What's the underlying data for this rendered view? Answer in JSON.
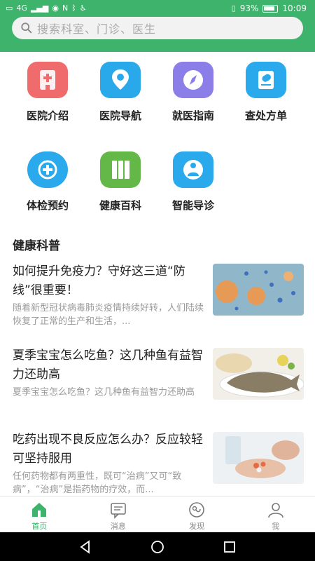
{
  "status_bar": {
    "network": "4G",
    "battery": "93%",
    "time": "10:09"
  },
  "search": {
    "placeholder": "搜索科室、门诊、医生"
  },
  "services": [
    {
      "label": "医院介绍",
      "icon": "hospital-icon",
      "color": "#f06b6b"
    },
    {
      "label": "医院导航",
      "icon": "location-pin-icon",
      "color": "#29a8ea"
    },
    {
      "label": "就医指南",
      "icon": "compass-icon",
      "color": "#8b7ee8"
    },
    {
      "label": "查处方单",
      "icon": "prescription-icon",
      "color": "#2aa9ec"
    },
    {
      "label": "体检预约",
      "icon": "checkup-icon",
      "color": "#2aa9ec"
    },
    {
      "label": "健康百科",
      "icon": "encyclopedia-icon",
      "color": "#64b847"
    },
    {
      "label": "智能导诊",
      "icon": "smart-guide-icon",
      "color": "#2aa9ec"
    }
  ],
  "section": {
    "title": "健康科普"
  },
  "articles": [
    {
      "title": "如何提升免疫力？守好这三道“防线”很重要！",
      "desc": "随着新型冠状病毒肺炎疫情持续好转，人们陆续恢复了正常的生产和生活，..."
    },
    {
      "title": "夏季宝宝怎么吃鱼？这几种鱼有益智力还助高",
      "desc": "夏季宝宝怎么吃鱼？这几种鱼有益智力还助高"
    },
    {
      "title": "吃药出现不良反应怎么办？反应较轻可坚持服用",
      "desc": "任何药物都有两重性，既可“治病”又可“致病”，“治病”是指药物的疗效，而..."
    }
  ],
  "tabs": [
    {
      "label": "首页",
      "active": true
    },
    {
      "label": "消息",
      "active": false
    },
    {
      "label": "发现",
      "active": false
    },
    {
      "label": "我",
      "active": false
    }
  ],
  "colors": {
    "brand": "#3db36b",
    "text": "#222222",
    "muted": "#9a9a9a"
  }
}
